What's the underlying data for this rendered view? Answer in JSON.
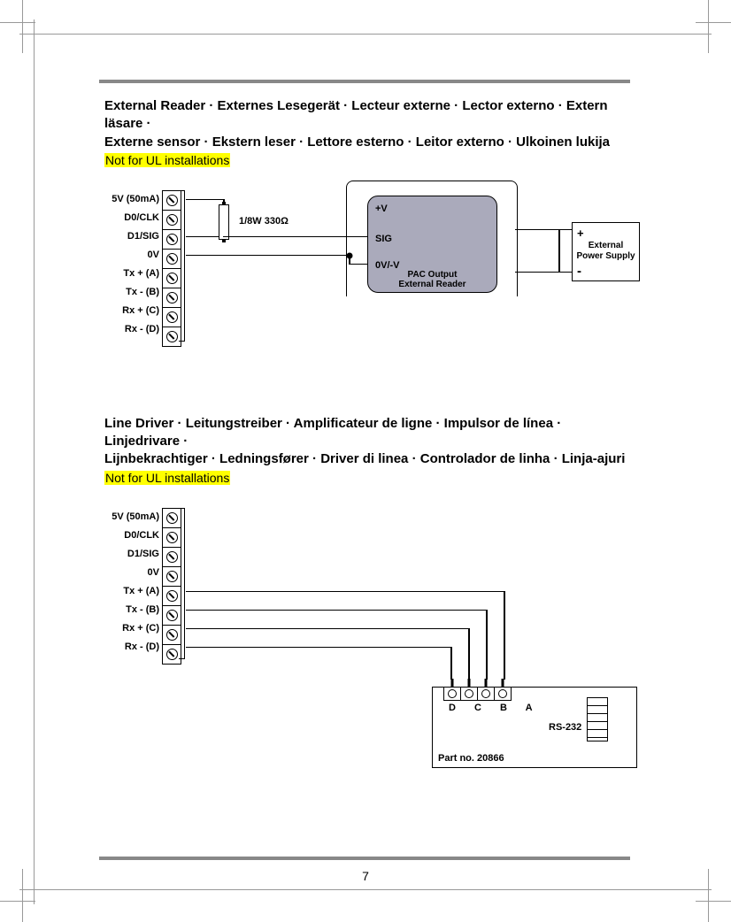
{
  "page_number": "7",
  "section1": {
    "title_line1": "External Reader · Externes Lesegerät · Lecteur externe · Lector externo · Extern läsare ·",
    "title_line2": "Externe sensor · Ekstern leser · Lettore esterno · Leitor externo · Ulkoinen lukija",
    "highlight": "Not for UL installations",
    "terminals": [
      "5V (50mA)",
      "D0/CLK",
      "D1/SIG",
      "0V",
      "Tx + (A)",
      "Tx - (B)",
      "Rx + (C)",
      "Rx - (D)"
    ],
    "resistor_label": "1/8W 330Ω",
    "pac_box": {
      "p1": "+V",
      "p2": "SIG",
      "p3": "0V/-V",
      "name1": "PAC Output",
      "name2": "External Reader"
    },
    "psu": {
      "label1": "External",
      "label2": "Power Supply",
      "plus": "+",
      "minus": "-"
    }
  },
  "section2": {
    "title_line1": "Line Driver · Leitungstreiber · Amplificateur de ligne · Impulsor de línea · Linjedrivare ·",
    "title_line2": "Lijnbekrachtiger · Ledningsfører · Driver di linea · Controlador de linha · Linja-ajuri",
    "highlight": "Not for UL installations",
    "terminals": [
      "5V (50mA)",
      "D0/CLK",
      "D1/SIG",
      "0V",
      "Tx + (A)",
      "Tx - (B)",
      "Rx + (C)",
      "Rx - (D)"
    ],
    "line_driver": {
      "pin_letters": "D   C   B   A",
      "rs232": "RS-232",
      "part_no": "Part no. 20866"
    }
  }
}
